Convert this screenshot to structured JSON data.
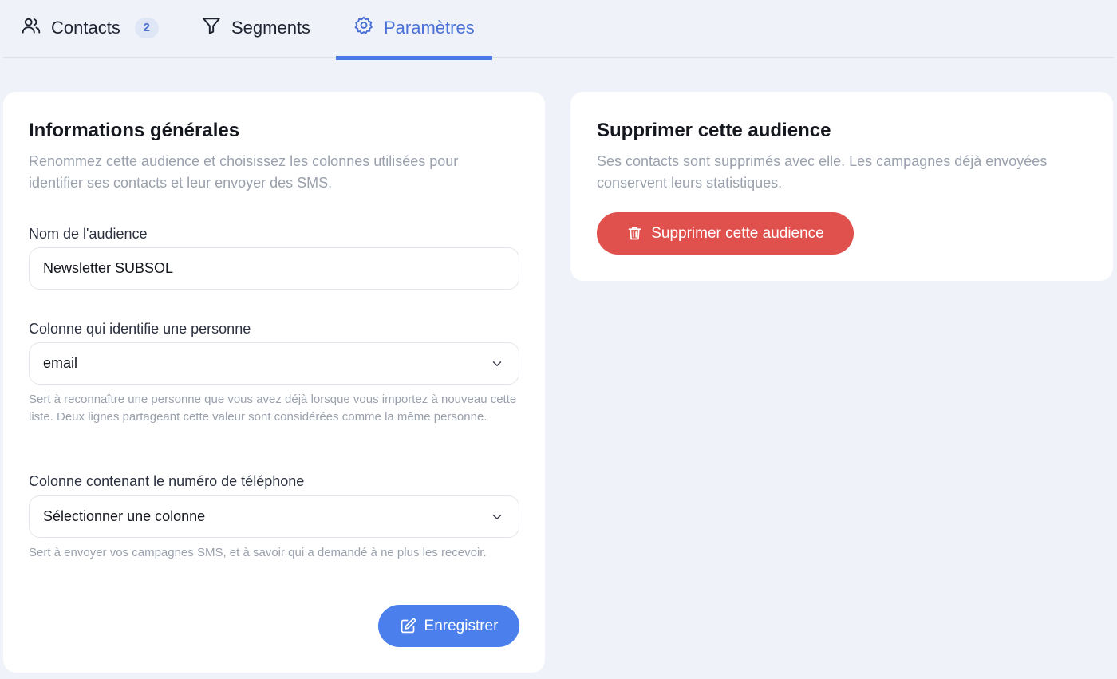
{
  "tabs": [
    {
      "label": "Contacts",
      "icon": "users-icon",
      "badge": "2"
    },
    {
      "label": "Segments",
      "icon": "filter-icon"
    },
    {
      "label": "Paramètres",
      "icon": "gear-icon",
      "active": true
    }
  ],
  "general": {
    "title": "Informations générales",
    "description": "Renommez cette audience et choisissez les colonnes utilisées pour identifier ses contacts et leur envoyer des SMS.",
    "name_label": "Nom de l'audience",
    "name_value": "Newsletter SUBSOL",
    "id_column_label": "Colonne qui identifie une personne",
    "id_column_value": "email",
    "id_column_help": "Sert à reconnaître une personne que vous avez déjà lorsque vous importez à nouveau cette liste. Deux lignes partageant cette valeur sont considérées comme la même personne.",
    "phone_column_label": "Colonne contenant le numéro de téléphone",
    "phone_column_value": "Sélectionner une colonne",
    "phone_column_help": "Sert à envoyer vos campagnes SMS, et à savoir qui a demandé à ne plus les recevoir.",
    "save_label": "Enregistrer"
  },
  "danger": {
    "title": "Supprimer cette audience",
    "description": "Ses contacts sont supprimés avec elle. Les campagnes déjà envoyées conservent leurs statistiques.",
    "delete_label": "Supprimer cette audience"
  },
  "colors": {
    "accent": "#4a78e8",
    "danger": "#e0504d",
    "background": "#eff3f9"
  }
}
